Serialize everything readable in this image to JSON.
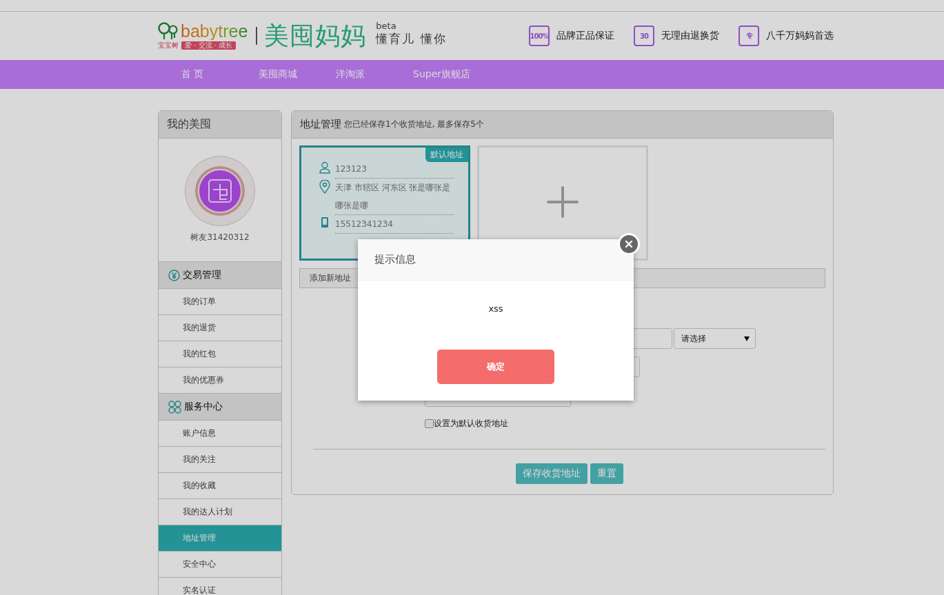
{
  "header": {
    "logo": {
      "name": "babytree",
      "cn_name": "宝宝树",
      "slogan": "爱 · 交流 · 成长"
    },
    "brand": "美囤妈妈",
    "beta": "beta",
    "tagline": "懂育儿 懂你",
    "promises": [
      {
        "badge": "100%",
        "label": "品牌正品保证"
      },
      {
        "badge": "30",
        "label": "无理由退换货"
      },
      {
        "badge": "专",
        "label": "八千万妈妈首选"
      }
    ]
  },
  "nav": [
    "首 页",
    "美囤商城",
    "洋淘派",
    "Super旗舰店"
  ],
  "sidebar": {
    "title": "我的美囤",
    "username": "树友31420312",
    "sections": [
      {
        "title": "交易管理",
        "items": [
          {
            "label": "我的订单",
            "selected": false
          },
          {
            "label": "我的退货",
            "selected": false
          },
          {
            "label": "我的红包",
            "selected": false
          },
          {
            "label": "我的优惠券",
            "selected": false
          }
        ]
      },
      {
        "title": "服务中心",
        "items": [
          {
            "label": "账户信息",
            "selected": false
          },
          {
            "label": "我的关注",
            "selected": false
          },
          {
            "label": "我的收藏",
            "selected": false
          },
          {
            "label": "我的达人计划",
            "selected": false
          },
          {
            "label": "地址管理",
            "selected": true
          },
          {
            "label": "安全中心",
            "selected": false
          },
          {
            "label": "实名认证",
            "selected": false
          }
        ]
      }
    ]
  },
  "main": {
    "title": "地址管理",
    "subtitle": "您已经保存1个收货地址, 最多保存5个",
    "addresses": [
      {
        "default_badge": "默认地址",
        "name": "123123",
        "address": "天津 市辖区 河东区 张是哪张是哪张是哪",
        "phone": "15512341234",
        "selected": true
      }
    ],
    "tab": "添加新地址",
    "select": {
      "value": "请选择"
    },
    "checkbox": {
      "label": "设置为默认收货地址",
      "checked": false
    },
    "buttons": [
      "保存收货地址",
      "重置"
    ]
  },
  "dialog": {
    "title": "提示信息",
    "message": "xss",
    "button": "确定"
  }
}
